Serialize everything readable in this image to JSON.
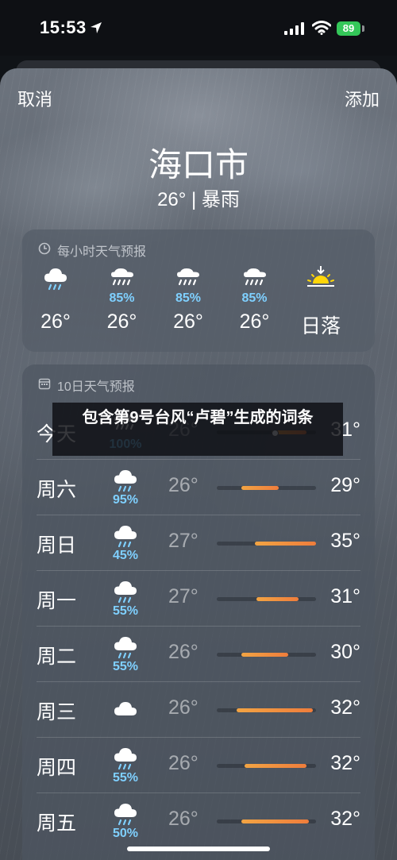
{
  "status_bar": {
    "time": "15:53",
    "battery": "89"
  },
  "nav": {
    "cancel_label": "取消",
    "add_label": "添加"
  },
  "location": {
    "city": "海口市",
    "condition": "26° | 暴雨"
  },
  "hourly": {
    "header": "每小时天气预报",
    "items": [
      {
        "icon": "rain-cloud-icon",
        "pct": "",
        "temp": "26°"
      },
      {
        "icon": "heavy-rain-cloud-icon",
        "pct": "85%",
        "temp": "26°"
      },
      {
        "icon": "heavy-rain-cloud-icon",
        "pct": "85%",
        "temp": "26°"
      },
      {
        "icon": "heavy-rain-cloud-icon",
        "pct": "85%",
        "temp": "26°"
      },
      {
        "icon": "sunset-icon",
        "pct": "",
        "temp": "日落"
      }
    ]
  },
  "daily": {
    "header": "10日天气预报",
    "days": [
      {
        "name": "今天",
        "icon": "heavy-rain-cloud-icon",
        "pct": "100%",
        "low": "26°",
        "high": "31°",
        "range": [
          0.55,
          0.9
        ],
        "current": 0.58
      },
      {
        "name": "周六",
        "icon": "rain-cloud-icon",
        "pct": "95%",
        "low": "26°",
        "high": "29°",
        "range": [
          0.25,
          0.62
        ]
      },
      {
        "name": "周日",
        "icon": "rain-cloud-icon",
        "pct": "45%",
        "low": "27°",
        "high": "35°",
        "range": [
          0.38,
          1.0
        ]
      },
      {
        "name": "周一",
        "icon": "rain-cloud-icon",
        "pct": "55%",
        "low": "27°",
        "high": "31°",
        "range": [
          0.4,
          0.82
        ]
      },
      {
        "name": "周二",
        "icon": "rain-cloud-icon",
        "pct": "55%",
        "low": "26°",
        "high": "30°",
        "range": [
          0.25,
          0.72
        ]
      },
      {
        "name": "周三",
        "icon": "cloud-icon",
        "pct": "",
        "low": "26°",
        "high": "32°",
        "range": [
          0.2,
          0.97
        ]
      },
      {
        "name": "周四",
        "icon": "rain-cloud-icon",
        "pct": "55%",
        "low": "26°",
        "high": "32°",
        "range": [
          0.28,
          0.9
        ]
      },
      {
        "name": "周五",
        "icon": "rain-cloud-icon",
        "pct": "50%",
        "low": "26°",
        "high": "32°",
        "range": [
          0.25,
          0.93
        ]
      }
    ]
  },
  "overlay": {
    "text": "包含第9号台风“卢碧”生成的词条"
  },
  "colors": {
    "accent_rain_pct": "#7fd0ff",
    "bar_orange": "#f2a443",
    "bar_deep_orange": "#ef7d3c",
    "battery": "#34c759"
  }
}
